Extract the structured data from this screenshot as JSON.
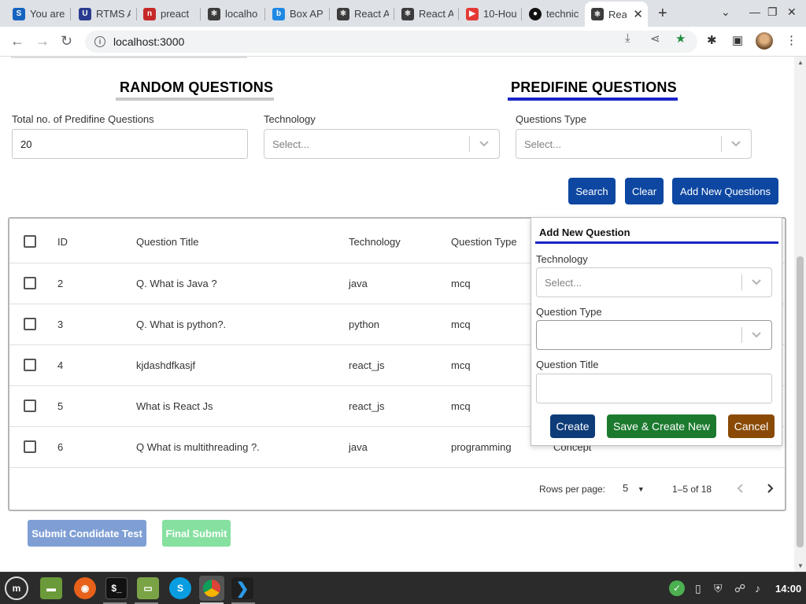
{
  "browser": {
    "tabs": [
      {
        "title": "You are",
        "icon": "stackoverflow-icon",
        "color": "#1565c0"
      },
      {
        "title": "RTMS A",
        "icon": "u-logo-icon",
        "color": "#2a3b8f"
      },
      {
        "title": "preact",
        "icon": "npm-icon",
        "color": "#c62828"
      },
      {
        "title": "localho",
        "icon": "react-icon",
        "color": "#3c3c3c"
      },
      {
        "title": "Box AP",
        "icon": "box-icon",
        "color": "#1e88e5"
      },
      {
        "title": "React A",
        "icon": "react-icon",
        "color": "#3c3c3c"
      },
      {
        "title": "React A",
        "icon": "react-icon",
        "color": "#3c3c3c"
      },
      {
        "title": "10-Hou",
        "icon": "youtube-icon",
        "color": "#e53935"
      },
      {
        "title": "technic",
        "icon": "github-icon",
        "color": "#111111"
      },
      {
        "title": "Rea",
        "icon": "react-icon",
        "color": "#3c3c3c"
      }
    ],
    "url": "localhost:3000"
  },
  "page": {
    "section_tabs": {
      "random": "RANDOM QUESTIONS",
      "predefined": "PREDIFINE QUESTIONS"
    },
    "filters": {
      "total_label": "Total no. of Predifine Questions",
      "total_value": "20",
      "technology_label": "Technology",
      "technology_placeholder": "Select...",
      "questions_type_label": "Questions Type",
      "questions_type_placeholder": "Select..."
    },
    "actions": {
      "search": "Search",
      "clear": "Clear",
      "add_new": "Add New Questions"
    },
    "table": {
      "headers": {
        "id": "ID",
        "title": "Question Title",
        "technology": "Technology",
        "type": "Question Type"
      },
      "rows": [
        {
          "id": "2",
          "title": "Q. What is Java ?",
          "technology": "java",
          "type": "mcq",
          "extra": ""
        },
        {
          "id": "3",
          "title": "Q. What is python?.",
          "technology": "python",
          "type": "mcq",
          "extra": ""
        },
        {
          "id": "4",
          "title": "kjdashdfkasjf",
          "technology": "react_js",
          "type": "mcq",
          "extra": ""
        },
        {
          "id": "5",
          "title": "What is React Js",
          "technology": "react_js",
          "type": "mcq",
          "extra": ""
        },
        {
          "id": "6",
          "title": "Q What is multithreading ?.",
          "technology": "java",
          "type": "programming",
          "extra": "Concept"
        }
      ],
      "pagination": {
        "rows_per_page_label": "Rows per page:",
        "rows_per_page": "5",
        "range": "1–5 of 18"
      }
    },
    "modal": {
      "title": "Add New Question",
      "technology_label": "Technology",
      "technology_placeholder": "Select...",
      "question_type_label": "Question Type",
      "question_title_label": "Question Title",
      "create": "Create",
      "save_create_new": "Save & Create New",
      "cancel": "Cancel"
    },
    "bottom": {
      "submit_candidate": "Submit Condidate Test",
      "final_submit": "Final Submit"
    }
  },
  "taskbar": {
    "clock": "14:00",
    "apps": [
      "mint-menu-icon",
      "files-icon",
      "firefox-icon",
      "terminal-icon",
      "folder-icon",
      "skype-icon",
      "chrome-icon",
      "vscode-icon"
    ]
  },
  "colors": {
    "primary": "#0d47a1",
    "create": "#0d3c78",
    "save": "#1b7a2e",
    "cancel": "#8a4a06",
    "submit_disabled": "#7f9fd4",
    "final_disabled": "#86e0a0",
    "active_tab_underline": "#1a25c7"
  }
}
